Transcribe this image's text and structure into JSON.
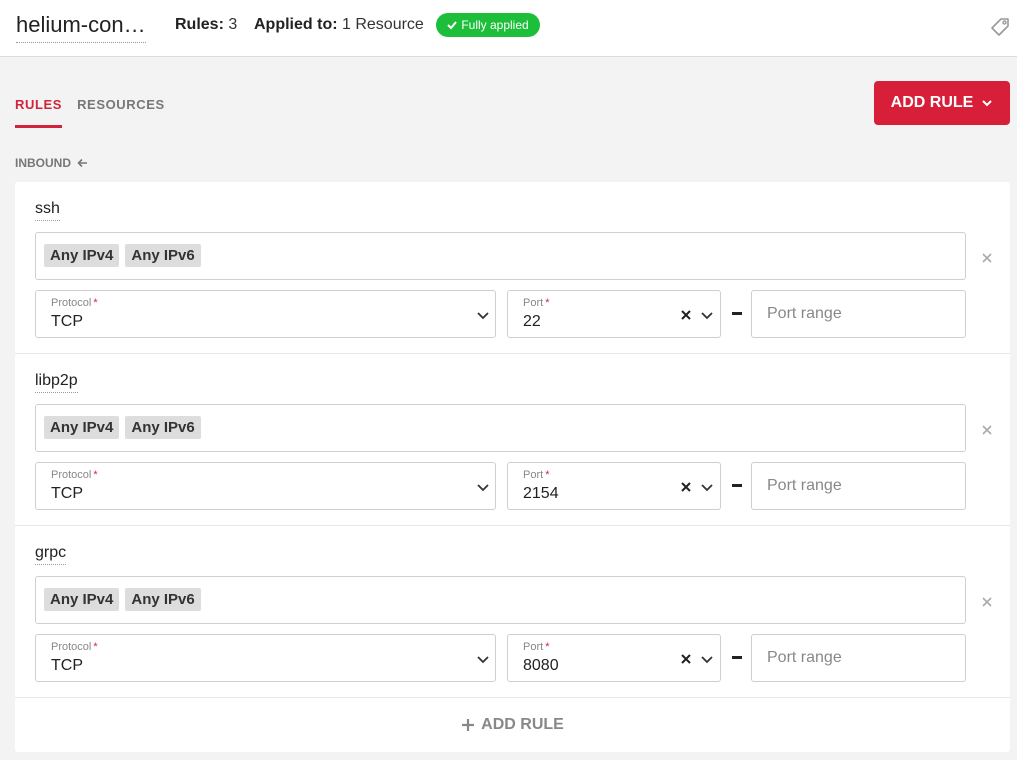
{
  "header": {
    "name": "helium-con…",
    "rules_label": "Rules:",
    "rules_count": "3",
    "applied_label": "Applied to:",
    "applied_value": "1 Resource",
    "status": "Fully applied",
    "status_color": "#1dbf3a"
  },
  "tabs": [
    {
      "label": "RULES",
      "active": true
    },
    {
      "label": "RESOURCES",
      "active": false
    }
  ],
  "add_rule_button": "ADD RULE",
  "section": {
    "label": "INBOUND"
  },
  "field_labels": {
    "protocol": "Protocol",
    "port": "Port",
    "required": "*",
    "port_range_placeholder": "Port range"
  },
  "rules": [
    {
      "name": "ssh",
      "sources": [
        "Any IPv4",
        "Any IPv6"
      ],
      "protocol": "TCP",
      "port": "22"
    },
    {
      "name": "libp2p",
      "sources": [
        "Any IPv4",
        "Any IPv6"
      ],
      "protocol": "TCP",
      "port": "2154"
    },
    {
      "name": "grpc",
      "sources": [
        "Any IPv4",
        "Any IPv6"
      ],
      "protocol": "TCP",
      "port": "8080"
    }
  ],
  "footer_add_rule": "ADD RULE",
  "colors": {
    "accent": "#d71f3a",
    "tab_active": "#d0243c"
  }
}
